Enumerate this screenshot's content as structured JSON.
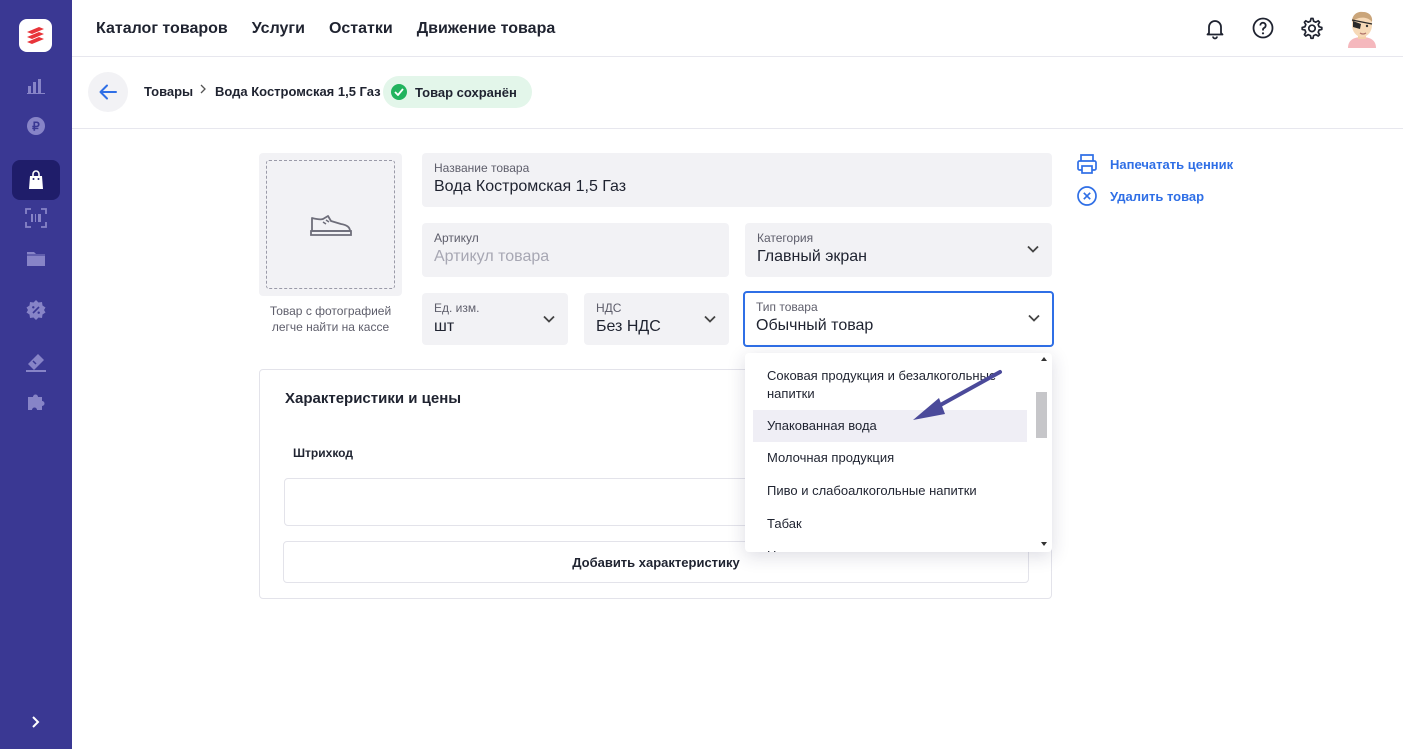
{
  "topnav": {
    "items": [
      "Каталог товаров",
      "Услуги",
      "Остатки",
      "Движение товара"
    ]
  },
  "breadcrumb": {
    "root": "Товары",
    "current": "Вода Костромская 1,5 Газ",
    "status": "Товар сохранён"
  },
  "photo": {
    "hint": "Товар с фотографией легче найти на кассе"
  },
  "form": {
    "name_label": "Название товара",
    "name_value": "Вода Костромская 1,5 Газ",
    "sku_label": "Артикул",
    "sku_placeholder": "Артикул товара",
    "category_label": "Категория",
    "category_value": "Главный экран",
    "unit_label": "Ед. изм.",
    "unit_value": "шт",
    "vat_label": "НДС",
    "vat_value": "Без НДС",
    "type_label": "Тип товара",
    "type_value": "Обычный товар"
  },
  "actions": {
    "print_label": "Напечатать ценник",
    "delete_label": "Удалить товар"
  },
  "characteristics": {
    "title": "Характеристики и цены",
    "barcode_header": "Штрихкод",
    "add_button": "Добавить характеристику"
  },
  "type_dropdown": {
    "options": [
      "Соковая продукция и безалкогольные напитки",
      "Упакованная вода",
      "Молочная продукция",
      "Пиво и слабоалкогольные напитки",
      "Табак"
    ],
    "highlighted": "Упакованная вода"
  },
  "colors": {
    "sidebar": "#3a3893",
    "sidebar_active": "#1f1d6a",
    "accent": "#2f6fe6",
    "success": "#22b35e",
    "annotation_arrow": "#4b4a9a"
  }
}
